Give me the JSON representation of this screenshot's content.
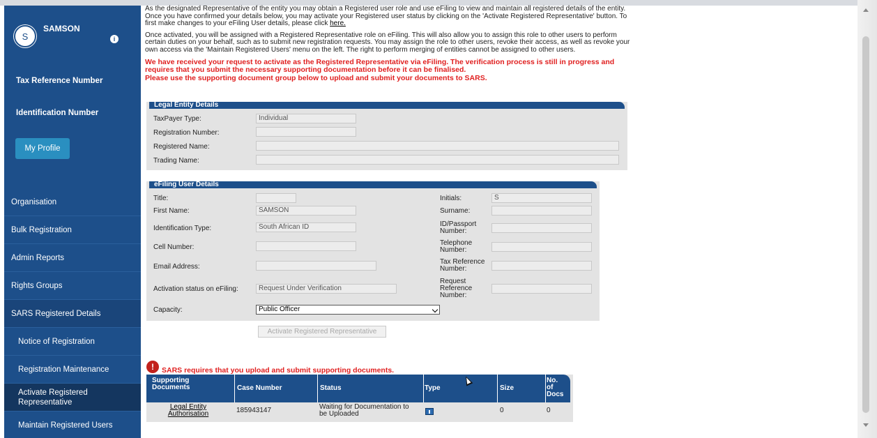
{
  "profile": {
    "avatar_letter": "S",
    "user_name": "SAMSON",
    "info_glyph": "i",
    "tax_ref_label": "Tax Reference Number",
    "id_label": "Identification Number",
    "my_profile_button": "My Profile"
  },
  "nav": {
    "items": [
      {
        "label": "Organisation"
      },
      {
        "label": "Bulk Registration"
      },
      {
        "label": "Admin Reports"
      },
      {
        "label": "Rights Groups"
      },
      {
        "label": "SARS Registered Details"
      },
      {
        "label": "Notice of Registration"
      },
      {
        "label": "Registration Maintenance"
      },
      {
        "label": "Activate Registered Representative"
      },
      {
        "label": "Maintain Registered Users"
      }
    ]
  },
  "intro": {
    "para1": "As the designated Representative of the entity you may obtain a Registered user role and use eFiling to view and maintain all registered details of the entity. Once you have confirmed your details below, you may activate your Registered user status by clicking on the 'Activate Registered Representative' button. To first make changes to your eFiling User details, please click",
    "para1_link": "here.",
    "para2": "Once activated, you will be assigned with a Registered Representative role on eFiling. This will also allow you to assign this role to other users to perform certain duties on your behalf, such as to submit new registration requests. You may assign the role to other users, revoke their access, as well as revoke your own access via the 'Maintain Registered Users' menu on the left. The right to perform merging of entities cannot be assigned to other users.",
    "alert1": "We have received your request to activate as the Registered Representative via eFiling. The verification process is still in progress and requires that you submit the necessary supporting documentation before it can be finalised.",
    "alert2": "Please use the supporting document group below to upload and submit your documents to SARS."
  },
  "legal_entity": {
    "header": "Legal Entity Details",
    "taxpayer_type_label": "TaxPayer Type:",
    "taxpayer_type_value": "Individual",
    "registration_number_label": "Registration Number:",
    "registration_number_value": "",
    "registered_name_label": "Registered Name:",
    "registered_name_value": "",
    "trading_name_label": "Trading Name:",
    "trading_name_value": ""
  },
  "efiling_user": {
    "header": "eFiling User Details",
    "title_label": "Title:",
    "title_value": "",
    "first_name_label": "First Name:",
    "first_name_value": "SAMSON",
    "id_type_label": "Identification Type:",
    "id_type_value": "South African ID",
    "cell_label": "Cell Number:",
    "cell_value": "",
    "email_label": "Email Address:",
    "email_value": "",
    "activation_status_label": "Activation status on eFiling:",
    "activation_status_value": "Request Under Verification",
    "capacity_label": "Capacity:",
    "capacity_value": "Public Officer",
    "initials_label": "Initials:",
    "initials_value": "S",
    "surname_label": "Surname:",
    "surname_value": "",
    "id_passport_label_1": "ID/Passport",
    "id_passport_label_2": "Number:",
    "id_passport_value": "",
    "telephone_label_1": "Telephone",
    "telephone_label_2": "Number:",
    "telephone_value": "",
    "tax_ref_label_1": "Tax Reference",
    "tax_ref_label_2": "Number:",
    "tax_ref_value": "",
    "request_ref_label_1": "Request",
    "request_ref_label_2": "Reference",
    "request_ref_label_3": "Number:",
    "request_ref_value": ""
  },
  "activate_button": "Activate Registered Representative",
  "warning": {
    "icon_glyph": "!",
    "text": "SARS requires that you upload and submit supporting documents."
  },
  "docs_table": {
    "headers": {
      "supporting_1": "Supporting",
      "supporting_2": "Documents",
      "case_number": "Case Number",
      "status": "Status",
      "type": "Type",
      "size": "Size",
      "no_docs_1": "No.",
      "no_docs_2": "of",
      "no_docs_3": "Docs"
    },
    "row": {
      "doc_1": "Legal Entity",
      "doc_2": "Authorisation",
      "case_number": "185943147",
      "status_1": "Waiting for Documentation to",
      "status_2": "be Uploaded",
      "size": "0",
      "no_docs": "0"
    }
  }
}
